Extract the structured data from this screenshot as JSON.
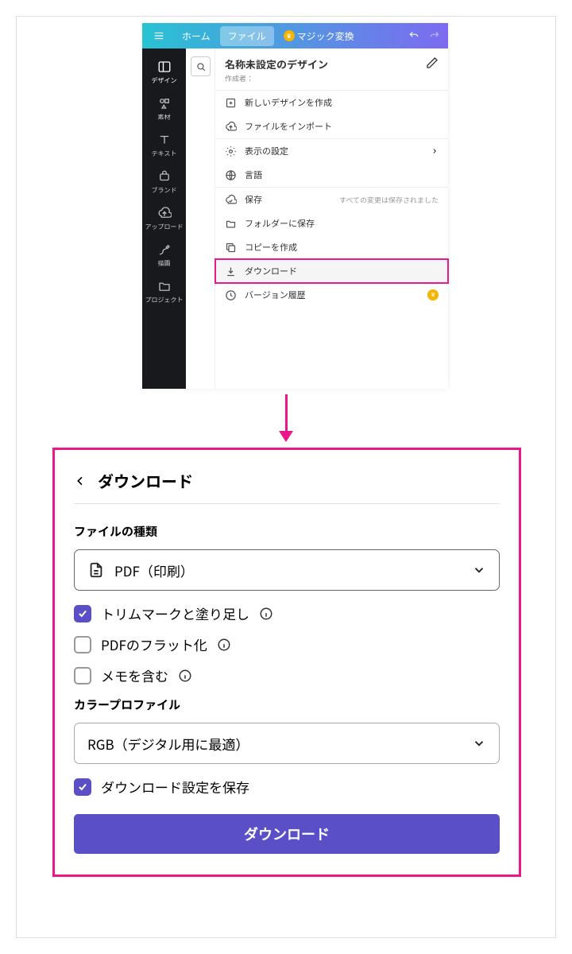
{
  "topbar": {
    "home": "ホーム",
    "file": "ファイル",
    "magic": "マジック変換"
  },
  "sidebar": {
    "design": "デザイン",
    "elements": "素材",
    "text": "テキスト",
    "brand": "ブランド",
    "upload": "アップロード",
    "draw": "描画",
    "projects": "プロジェクト"
  },
  "dropdown": {
    "title": "名称未設定のデザイン",
    "author_label": "作成者：",
    "new_design": "新しいデザインを作成",
    "import": "ファイルをインポート",
    "view_settings": "表示の設定",
    "language": "言語",
    "save": "保存",
    "save_status": "すべての変更は保存されました",
    "save_folder": "フォルダーに保存",
    "copy": "コピーを作成",
    "download": "ダウンロード",
    "version": "バージョン履歴"
  },
  "download_panel": {
    "title": "ダウンロード",
    "file_type_label": "ファイルの種類",
    "file_type_value": "PDF（印刷）",
    "opt_trim": "トリムマークと塗り足し",
    "opt_flatten": "PDFのフラット化",
    "opt_notes": "メモを含む",
    "color_profile_label": "カラープロファイル",
    "color_profile_value": "RGB（デジタル用に最適）",
    "save_settings": "ダウンロード設定を保存",
    "button": "ダウンロード"
  }
}
